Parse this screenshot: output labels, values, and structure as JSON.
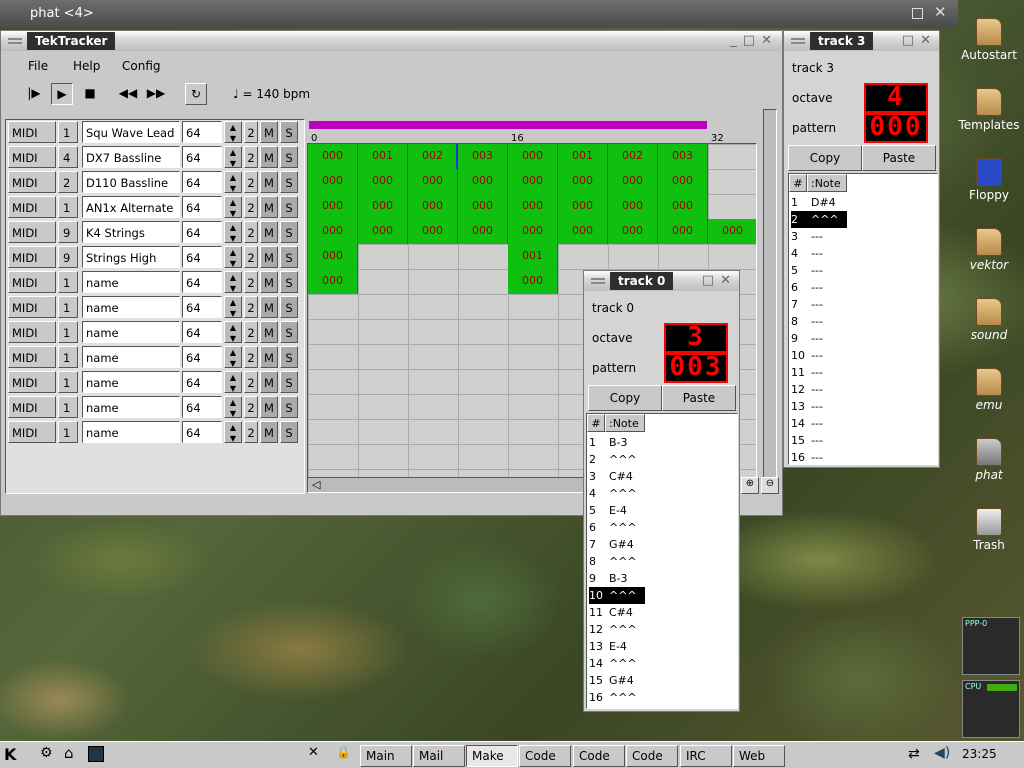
{
  "top_window": {
    "title": "phat <4>"
  },
  "main": {
    "title": "TekTracker",
    "menu": [
      "File",
      "Help",
      "Config"
    ],
    "tempo": "= 140 bpm",
    "ruler": [
      "0",
      "16",
      "32"
    ],
    "tracks": [
      {
        "type": "MIDI",
        "ch": "1",
        "name": "Squ Wave Lead",
        "vol": "64",
        "n": "2",
        "m": "M",
        "s": "S",
        "blocks": [
          "000",
          "001",
          "002",
          "003",
          "000",
          "001",
          "002",
          "003"
        ]
      },
      {
        "type": "MIDI",
        "ch": "4",
        "name": "DX7 Bassline",
        "vol": "64",
        "n": "2",
        "m": "M",
        "s": "S",
        "blocks": [
          "000",
          "000",
          "000",
          "000",
          "000",
          "000",
          "000",
          "000"
        ]
      },
      {
        "type": "MIDI",
        "ch": "2",
        "name": "D110 Bassline",
        "vol": "64",
        "n": "2",
        "m": "M",
        "s": "S",
        "blocks": [
          "000",
          "000",
          "000",
          "000",
          "000",
          "000",
          "000",
          "000"
        ]
      },
      {
        "type": "MIDI",
        "ch": "1",
        "name": "AN1x Alternate",
        "vol": "64",
        "n": "2",
        "m": "M",
        "s": "S",
        "blocks": [
          "000",
          "000",
          "000",
          "000",
          "000",
          "000",
          "000",
          "000",
          "000"
        ]
      },
      {
        "type": "MIDI",
        "ch": "9",
        "name": "K4 Strings",
        "vol": "64",
        "n": "2",
        "m": "M",
        "s": "S",
        "blocks": [
          "000",
          "001"
        ]
      },
      {
        "type": "MIDI",
        "ch": "9",
        "name": "Strings High",
        "vol": "64",
        "n": "2",
        "m": "M",
        "s": "S",
        "blocks": [
          "000",
          "000"
        ]
      },
      {
        "type": "MIDI",
        "ch": "1",
        "name": "name",
        "vol": "64",
        "n": "2",
        "m": "M",
        "s": "S",
        "blocks": []
      },
      {
        "type": "MIDI",
        "ch": "1",
        "name": "name",
        "vol": "64",
        "n": "2",
        "m": "M",
        "s": "S",
        "blocks": []
      },
      {
        "type": "MIDI",
        "ch": "1",
        "name": "name",
        "vol": "64",
        "n": "2",
        "m": "M",
        "s": "S",
        "blocks": []
      },
      {
        "type": "MIDI",
        "ch": "1",
        "name": "name",
        "vol": "64",
        "n": "2",
        "m": "M",
        "s": "S",
        "blocks": []
      },
      {
        "type": "MIDI",
        "ch": "1",
        "name": "name",
        "vol": "64",
        "n": "2",
        "m": "M",
        "s": "S",
        "blocks": []
      },
      {
        "type": "MIDI",
        "ch": "1",
        "name": "name",
        "vol": "64",
        "n": "2",
        "m": "M",
        "s": "S",
        "blocks": []
      },
      {
        "type": "MIDI",
        "ch": "1",
        "name": "name",
        "vol": "64",
        "n": "2",
        "m": "M",
        "s": "S",
        "blocks": []
      }
    ]
  },
  "track3": {
    "title": "track 3",
    "name": "track 3",
    "octave_label": "octave",
    "octave": "4",
    "pattern_label": "pattern",
    "pattern": "000",
    "copy": "Copy",
    "paste": "Paste",
    "col_num": "#",
    "col_note": ":Note",
    "notes": [
      "D#4",
      "^^^",
      "---",
      "---",
      "---",
      "---",
      "---",
      "---",
      "---",
      "---",
      "---",
      "---",
      "---",
      "---",
      "---",
      "---"
    ],
    "selected": 2
  },
  "track0": {
    "title": "track 0",
    "name": "track 0",
    "octave_label": "octave",
    "octave": "3",
    "pattern_label": "pattern",
    "pattern": "003",
    "copy": "Copy",
    "paste": "Paste",
    "col_num": "#",
    "col_note": ":Note",
    "notes": [
      "B-3",
      "^^^",
      "C#4",
      "^^^",
      "E-4",
      "^^^",
      "G#4",
      "^^^",
      "B-3",
      "^^^",
      "C#4",
      "^^^",
      "E-4",
      "^^^",
      "G#4",
      "^^^"
    ],
    "selected": 10
  },
  "desktop": [
    "Autostart",
    "Templates",
    "Floppy",
    "vektor",
    "sound",
    "emu",
    "phat",
    "Trash"
  ],
  "taskbar": {
    "tasks": [
      "Main",
      "Mail",
      "Make",
      "Code",
      "Code",
      "Code",
      "IRC",
      "Web"
    ],
    "active": "Make",
    "clock": "23:25",
    "ppp": "PPP-0",
    "cpu": "CPU"
  }
}
